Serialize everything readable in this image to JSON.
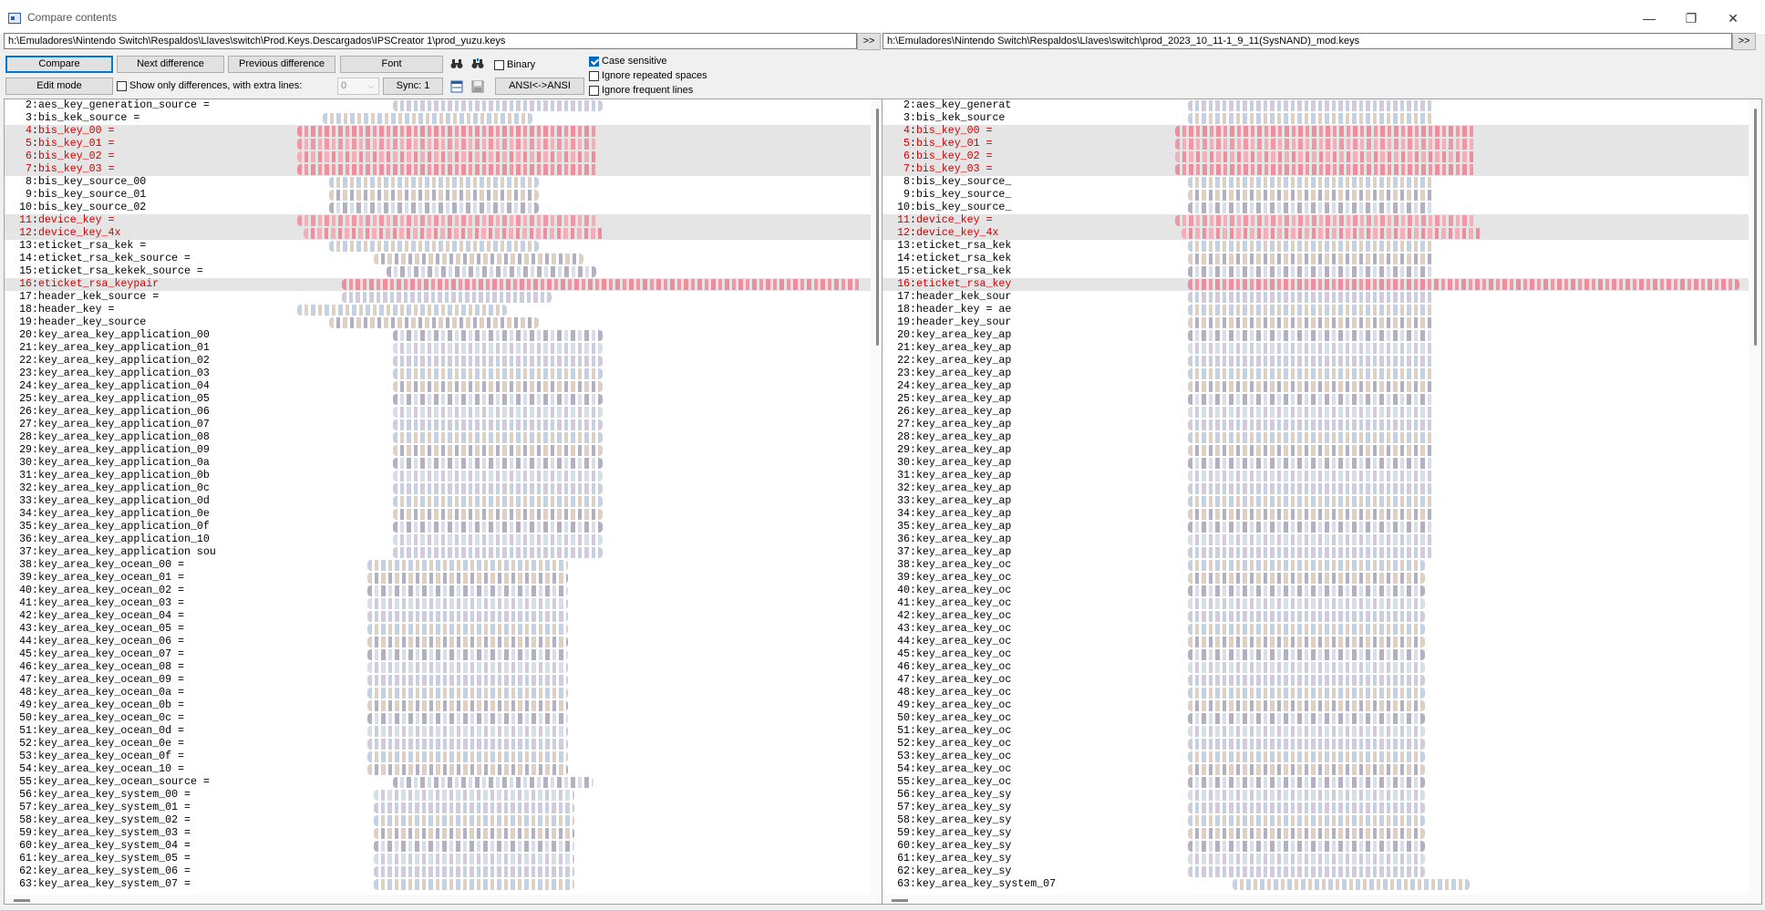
{
  "window": {
    "title": "Compare contents",
    "minimize": "—",
    "maximize": "❐",
    "close": "✕"
  },
  "paths": {
    "left": "h:\\Emuladores\\Nintendo Switch\\Respaldos\\Llaves\\switch\\Prod.Keys.Descargados\\IPSCreator 1\\prod_yuzu.keys",
    "right": "h:\\Emuladores\\Nintendo Switch\\Respaldos\\Llaves\\switch\\prod_2023_10_11-1_9_11(SysNAND)_mod.keys",
    "go_label": ">>"
  },
  "toolbar": {
    "compare": "Compare",
    "next_difference": "Next difference",
    "previous_difference": "Previous difference",
    "font": "Font",
    "binary": "Binary",
    "edit_mode": "Edit mode",
    "show_only_diff": "Show only differences, with extra lines:",
    "extra_lines_value": "0",
    "sync": "Sync: 1",
    "ansi": "ANSI<->ANSI",
    "case_sensitive": "Case sensitive",
    "ignore_repeated_spaces": "Ignore repeated spaces",
    "ignore_frequent_lines": "Ignore frequent lines"
  },
  "checks": {
    "binary": false,
    "show_only_diff": false,
    "case_sensitive": true,
    "ignore_repeated_spaces": false,
    "ignore_frequent_lines": false
  },
  "left_lines": [
    {
      "n": "2",
      "t": "aes_key_generation_source = ",
      "d": false
    },
    {
      "n": "3",
      "t": "bis_kek_source = ",
      "d": false
    },
    {
      "n": "4",
      "t": "bis_key_00 = ",
      "d": true
    },
    {
      "n": "5",
      "t": "bis_key_01 = ",
      "d": true
    },
    {
      "n": "6",
      "t": "bis_key_02 = ",
      "d": true
    },
    {
      "n": "7",
      "t": "bis_key_03 = ",
      "d": true
    },
    {
      "n": "8",
      "t": "bis_key_source_00 ",
      "d": false
    },
    {
      "n": "9",
      "t": "bis_key_source_01 ",
      "d": false
    },
    {
      "n": "10",
      "t": "bis_key_source_02 ",
      "d": false
    },
    {
      "n": "11",
      "t": "device_key = ",
      "d": true
    },
    {
      "n": "12",
      "t": "device_key_4x ",
      "d": true
    },
    {
      "n": "13",
      "t": "eticket_rsa_kek = ",
      "d": false
    },
    {
      "n": "14",
      "t": "eticket_rsa_kek_source = ",
      "d": false
    },
    {
      "n": "15",
      "t": "eticket_rsa_kekek_source = ",
      "d": false
    },
    {
      "n": "16",
      "t": "eticket_rsa_keypair ",
      "d": true
    },
    {
      "n": "17",
      "t": "header_kek_source = ",
      "d": false
    },
    {
      "n": "18",
      "t": "header_key = ",
      "d": false
    },
    {
      "n": "19",
      "t": "header_key_source ",
      "d": false
    },
    {
      "n": "20",
      "t": "key_area_key_application_00 ",
      "d": false
    },
    {
      "n": "21",
      "t": "key_area_key_application_01 ",
      "d": false
    },
    {
      "n": "22",
      "t": "key_area_key_application_02 ",
      "d": false
    },
    {
      "n": "23",
      "t": "key_area_key_application_03 ",
      "d": false
    },
    {
      "n": "24",
      "t": "key_area_key_application_04 ",
      "d": false
    },
    {
      "n": "25",
      "t": "key_area_key_application_05 ",
      "d": false
    },
    {
      "n": "26",
      "t": "key_area_key_application_06 ",
      "d": false
    },
    {
      "n": "27",
      "t": "key_area_key_application_07 ",
      "d": false
    },
    {
      "n": "28",
      "t": "key_area_key_application_08 ",
      "d": false
    },
    {
      "n": "29",
      "t": "key_area_key_application_09 ",
      "d": false
    },
    {
      "n": "30",
      "t": "key_area_key_application_0a ",
      "d": false
    },
    {
      "n": "31",
      "t": "key_area_key_application_0b ",
      "d": false
    },
    {
      "n": "32",
      "t": "key_area_key_application_0c ",
      "d": false
    },
    {
      "n": "33",
      "t": "key_area_key_application_0d ",
      "d": false
    },
    {
      "n": "34",
      "t": "key_area_key_application_0e ",
      "d": false
    },
    {
      "n": "35",
      "t": "key_area_key_application_0f ",
      "d": false
    },
    {
      "n": "36",
      "t": "key_area_key_application_10 ",
      "d": false
    },
    {
      "n": "37",
      "t": "key_area_key_application sou",
      "d": false
    },
    {
      "n": "38",
      "t": "key_area_key_ocean_00 = ",
      "d": false
    },
    {
      "n": "39",
      "t": "key_area_key_ocean_01 = ",
      "d": false
    },
    {
      "n": "40",
      "t": "key_area_key_ocean_02 = ",
      "d": false
    },
    {
      "n": "41",
      "t": "key_area_key_ocean_03 = ",
      "d": false
    },
    {
      "n": "42",
      "t": "key_area_key_ocean_04 = ",
      "d": false
    },
    {
      "n": "43",
      "t": "key_area_key_ocean_05 = ",
      "d": false
    },
    {
      "n": "44",
      "t": "key_area_key_ocean_06 = ",
      "d": false
    },
    {
      "n": "45",
      "t": "key_area_key_ocean_07 = ",
      "d": false
    },
    {
      "n": "46",
      "t": "key_area_key_ocean_08 = ",
      "d": false
    },
    {
      "n": "47",
      "t": "key_area_key_ocean_09 = ",
      "d": false
    },
    {
      "n": "48",
      "t": "key_area_key_ocean_0a = ",
      "d": false
    },
    {
      "n": "49",
      "t": "key_area_key_ocean_0b = ",
      "d": false
    },
    {
      "n": "50",
      "t": "key_area_key_ocean_0c = ",
      "d": false
    },
    {
      "n": "51",
      "t": "key_area_key_ocean_0d = ",
      "d": false
    },
    {
      "n": "52",
      "t": "key_area_key_ocean_0e = ",
      "d": false
    },
    {
      "n": "53",
      "t": "key_area_key_ocean_0f = ",
      "d": false
    },
    {
      "n": "54",
      "t": "key_area_key_ocean_10 = ",
      "d": false
    },
    {
      "n": "55",
      "t": "key_area_key_ocean_source = ",
      "d": false
    },
    {
      "n": "56",
      "t": "key_area_key_system_00 = ",
      "d": false
    },
    {
      "n": "57",
      "t": "key_area_key_system_01 = ",
      "d": false
    },
    {
      "n": "58",
      "t": "key_area_key_system_02 = ",
      "d": false
    },
    {
      "n": "59",
      "t": "key_area_key_system_03 = ",
      "d": false
    },
    {
      "n": "60",
      "t": "key_area_key_system_04 = ",
      "d": false
    },
    {
      "n": "61",
      "t": "key_area_key_system_05 = ",
      "d": false
    },
    {
      "n": "62",
      "t": "key_area_key_system_06 = ",
      "d": false
    },
    {
      "n": "63",
      "t": "key_area_key_system_07 = ",
      "d": false
    }
  ],
  "right_lines": [
    {
      "n": "2",
      "t": "aes_key_generat",
      "d": false
    },
    {
      "n": "3",
      "t": "bis_kek_source ",
      "d": false
    },
    {
      "n": "4",
      "t": "bis_key_00 = ",
      "d": true
    },
    {
      "n": "5",
      "t": "bis_key_01 = ",
      "d": true
    },
    {
      "n": "6",
      "t": "bis_key_02 = ",
      "d": true
    },
    {
      "n": "7",
      "t": "bis_key_03 = ",
      "d": true
    },
    {
      "n": "8",
      "t": "bis_key_source_",
      "d": false
    },
    {
      "n": "9",
      "t": "bis_key_source_",
      "d": false
    },
    {
      "n": "10",
      "t": "bis_key_source_",
      "d": false
    },
    {
      "n": "11",
      "t": "device_key = ",
      "d": true
    },
    {
      "n": "12",
      "t": "device_key_4x ",
      "d": true
    },
    {
      "n": "13",
      "t": "eticket_rsa_kek",
      "d": false
    },
    {
      "n": "14",
      "t": "eticket_rsa_kek",
      "d": false
    },
    {
      "n": "15",
      "t": "eticket_rsa_kek",
      "d": false
    },
    {
      "n": "16",
      "t": "eticket_rsa_key",
      "d": true
    },
    {
      "n": "17",
      "t": "header_kek_sour",
      "d": false
    },
    {
      "n": "18",
      "t": "header_key = ae",
      "d": false
    },
    {
      "n": "19",
      "t": "header_key_sour",
      "d": false
    },
    {
      "n": "20",
      "t": "key_area_key_ap",
      "d": false
    },
    {
      "n": "21",
      "t": "key_area_key_ap",
      "d": false
    },
    {
      "n": "22",
      "t": "key_area_key_ap",
      "d": false
    },
    {
      "n": "23",
      "t": "key_area_key_ap",
      "d": false
    },
    {
      "n": "24",
      "t": "key_area_key_ap",
      "d": false
    },
    {
      "n": "25",
      "t": "key_area_key_ap",
      "d": false
    },
    {
      "n": "26",
      "t": "key_area_key_ap",
      "d": false
    },
    {
      "n": "27",
      "t": "key_area_key_ap",
      "d": false
    },
    {
      "n": "28",
      "t": "key_area_key_ap",
      "d": false
    },
    {
      "n": "29",
      "t": "key_area_key_ap",
      "d": false
    },
    {
      "n": "30",
      "t": "key_area_key_ap",
      "d": false
    },
    {
      "n": "31",
      "t": "key_area_key_ap",
      "d": false
    },
    {
      "n": "32",
      "t": "key_area_key_ap",
      "d": false
    },
    {
      "n": "33",
      "t": "key_area_key_ap",
      "d": false
    },
    {
      "n": "34",
      "t": "key_area_key_ap",
      "d": false
    },
    {
      "n": "35",
      "t": "key_area_key_ap",
      "d": false
    },
    {
      "n": "36",
      "t": "key_area_key_ap",
      "d": false
    },
    {
      "n": "37",
      "t": "key_area_key_ap",
      "d": false
    },
    {
      "n": "38",
      "t": "key_area_key_oc",
      "d": false
    },
    {
      "n": "39",
      "t": "key_area_key_oc",
      "d": false
    },
    {
      "n": "40",
      "t": "key_area_key_oc",
      "d": false
    },
    {
      "n": "41",
      "t": "key_area_key_oc",
      "d": false
    },
    {
      "n": "42",
      "t": "key_area_key_oc",
      "d": false
    },
    {
      "n": "43",
      "t": "key_area_key_oc",
      "d": false
    },
    {
      "n": "44",
      "t": "key_area_key_oc",
      "d": false
    },
    {
      "n": "45",
      "t": "key_area_key_oc",
      "d": false
    },
    {
      "n": "46",
      "t": "key_area_key_oc",
      "d": false
    },
    {
      "n": "47",
      "t": "key_area_key_oc",
      "d": false
    },
    {
      "n": "48",
      "t": "key_area_key_oc",
      "d": false
    },
    {
      "n": "49",
      "t": "key_area_key_oc",
      "d": false
    },
    {
      "n": "50",
      "t": "key_area_key_oc",
      "d": false
    },
    {
      "n": "51",
      "t": "key_area_key_oc",
      "d": false
    },
    {
      "n": "52",
      "t": "key_area_key_oc",
      "d": false
    },
    {
      "n": "53",
      "t": "key_area_key_oc",
      "d": false
    },
    {
      "n": "54",
      "t": "key_area_key_oc",
      "d": false
    },
    {
      "n": "55",
      "t": "key_area_key_oc",
      "d": false
    },
    {
      "n": "56",
      "t": "key_area_key_sy",
      "d": false
    },
    {
      "n": "57",
      "t": "key_area_key_sy",
      "d": false
    },
    {
      "n": "58",
      "t": "key_area_key_sy",
      "d": false
    },
    {
      "n": "59",
      "t": "key_area_key_sy",
      "d": false
    },
    {
      "n": "60",
      "t": "key_area_key_sy",
      "d": false
    },
    {
      "n": "61",
      "t": "key_area_key_sy",
      "d": false
    },
    {
      "n": "62",
      "t": "key_area_key_sy",
      "d": false
    },
    {
      "n": "63",
      "t": "key_area_key_system_07",
      "d": false
    }
  ],
  "colors": {
    "accent": "#0078d7",
    "diff_text": "#d40000",
    "diff_background": "#e5e5e5"
  }
}
